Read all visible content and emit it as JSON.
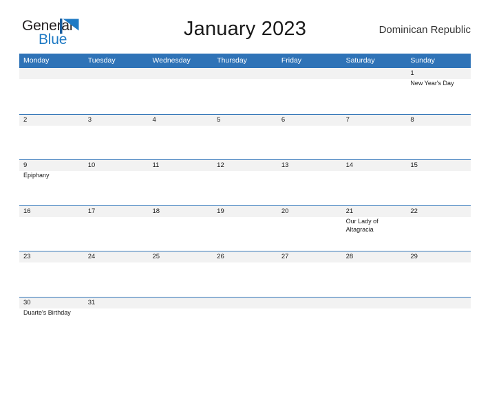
{
  "brand": {
    "name_part1": "General",
    "name_part2": "Blue",
    "flag_icon": "blue-triangle-flag-icon",
    "color_dark": "#231f20",
    "color_blue": "#1f7ac4"
  },
  "header": {
    "title": "January 2023",
    "country": "Dominican Republic"
  },
  "theme": {
    "header_blue": "#2f73b7",
    "band_gray": "#f2f2f2",
    "text_dark": "#1a1a1a",
    "page_background": "#ffffff"
  },
  "calendar": {
    "weekdays": [
      "Monday",
      "Tuesday",
      "Wednesday",
      "Thursday",
      "Friday",
      "Saturday",
      "Sunday"
    ],
    "weeks": [
      [
        {
          "day": "",
          "event": ""
        },
        {
          "day": "",
          "event": ""
        },
        {
          "day": "",
          "event": ""
        },
        {
          "day": "",
          "event": ""
        },
        {
          "day": "",
          "event": ""
        },
        {
          "day": "",
          "event": ""
        },
        {
          "day": "1",
          "event": "New Year's Day"
        }
      ],
      [
        {
          "day": "2",
          "event": ""
        },
        {
          "day": "3",
          "event": ""
        },
        {
          "day": "4",
          "event": ""
        },
        {
          "day": "5",
          "event": ""
        },
        {
          "day": "6",
          "event": ""
        },
        {
          "day": "7",
          "event": ""
        },
        {
          "day": "8",
          "event": ""
        }
      ],
      [
        {
          "day": "9",
          "event": "Epiphany"
        },
        {
          "day": "10",
          "event": ""
        },
        {
          "day": "11",
          "event": ""
        },
        {
          "day": "12",
          "event": ""
        },
        {
          "day": "13",
          "event": ""
        },
        {
          "day": "14",
          "event": ""
        },
        {
          "day": "15",
          "event": ""
        }
      ],
      [
        {
          "day": "16",
          "event": ""
        },
        {
          "day": "17",
          "event": ""
        },
        {
          "day": "18",
          "event": ""
        },
        {
          "day": "19",
          "event": ""
        },
        {
          "day": "20",
          "event": ""
        },
        {
          "day": "21",
          "event": "Our Lady of Altagracia"
        },
        {
          "day": "22",
          "event": ""
        }
      ],
      [
        {
          "day": "23",
          "event": ""
        },
        {
          "day": "24",
          "event": ""
        },
        {
          "day": "25",
          "event": ""
        },
        {
          "day": "26",
          "event": ""
        },
        {
          "day": "27",
          "event": ""
        },
        {
          "day": "28",
          "event": ""
        },
        {
          "day": "29",
          "event": ""
        }
      ],
      [
        {
          "day": "30",
          "event": "Duarte's Birthday"
        },
        {
          "day": "31",
          "event": ""
        },
        {
          "day": "",
          "event": ""
        },
        {
          "day": "",
          "event": ""
        },
        {
          "day": "",
          "event": ""
        },
        {
          "day": "",
          "event": ""
        },
        {
          "day": "",
          "event": ""
        }
      ]
    ]
  }
}
